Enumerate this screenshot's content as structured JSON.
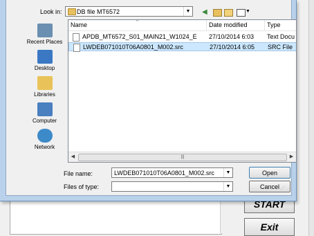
{
  "background": {
    "start_label": "START",
    "exit_label": "Exit"
  },
  "dialog": {
    "look_in_label": "Look in:",
    "look_in_value": "DB file MT6572",
    "places": [
      {
        "label": "Recent Places",
        "icon": "recent-places-icon"
      },
      {
        "label": "Desktop",
        "icon": "desktop-icon"
      },
      {
        "label": "Libraries",
        "icon": "libraries-icon"
      },
      {
        "label": "Computer",
        "icon": "computer-icon"
      },
      {
        "label": "Network",
        "icon": "network-icon"
      }
    ],
    "columns": {
      "name": "Name",
      "date": "Date modified",
      "type": "Type"
    },
    "files": [
      {
        "name": "APDB_MT6572_S01_MAIN21_W1024_E",
        "date": "27/10/2014 6:03",
        "type": "Text Docu"
      },
      {
        "name": "LWDEB071010T06A0801_M002.src",
        "date": "27/10/2014 6:05",
        "type": "SRC File"
      }
    ],
    "file_name_label": "File name:",
    "file_name_value": "LWDEB071010T06A0801_M002.src",
    "files_of_type_label": "Files of type:",
    "files_of_type_value": "",
    "open_label": "Open",
    "cancel_label": "Cancel"
  }
}
